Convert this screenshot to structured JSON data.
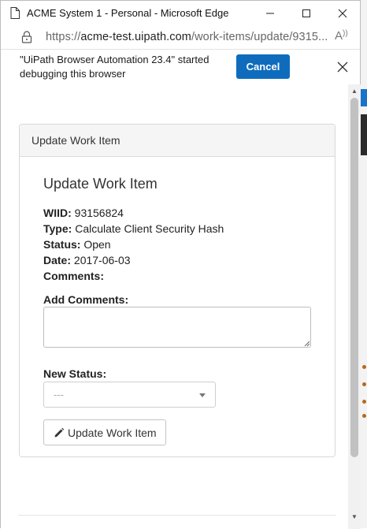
{
  "window": {
    "title": "ACME System 1 - Personal - Microsoft Edge",
    "minimize_icon": "minimize-icon",
    "maximize_icon": "maximize-icon",
    "close_icon": "close-icon"
  },
  "address_bar": {
    "url_prefix": "https://",
    "url_host": "acme-test.uipath.com",
    "url_path": "/work-items/update/9315..."
  },
  "infobar": {
    "message": "\"UiPath Browser Automation 23.4\" started debugging this browser",
    "cancel_label": "Cancel"
  },
  "panel": {
    "header": "Update Work Item"
  },
  "form": {
    "title": "Update Work Item",
    "wiid_label": "WIID:",
    "wiid_value": "93156824",
    "type_label": "Type:",
    "type_value": "Calculate Client Security Hash",
    "status_label": "Status:",
    "status_value": "Open",
    "date_label": "Date:",
    "date_value": "2017-06-03",
    "comments_label": "Comments:",
    "add_comments_label": "Add Comments:",
    "add_comments_value": "",
    "new_status_label": "New Status:",
    "new_status_selected": "---",
    "submit_label": "Update Work Item"
  },
  "colors": {
    "accent": "#0f6cbd",
    "panel_header_bg": "#f5f5f5"
  }
}
